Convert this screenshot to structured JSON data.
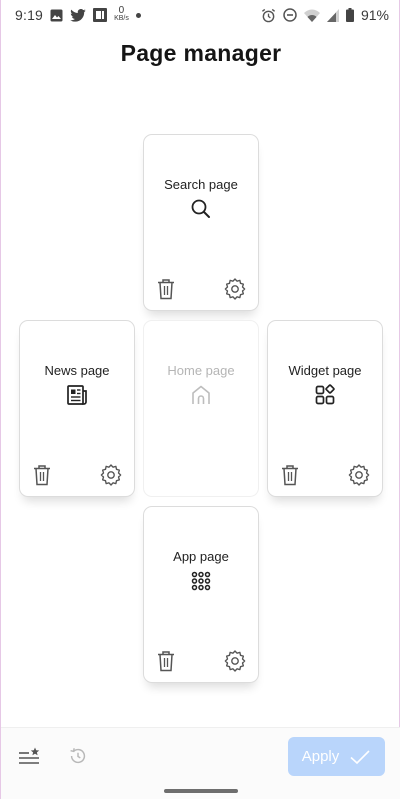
{
  "status_bar": {
    "time": "9:19",
    "net_speed_value": "0",
    "net_speed_unit": "KB/s",
    "battery": "91%",
    "icons": [
      "gallery-icon",
      "twitter-icon",
      "news-app-icon",
      "alarm-icon",
      "dnd-icon",
      "wifi-icon",
      "signal-icon",
      "battery-icon"
    ]
  },
  "title": "Page manager",
  "pages": {
    "search": {
      "label": "Search page",
      "icon": "search-icon"
    },
    "news": {
      "label": "News page",
      "icon": "newspaper-icon"
    },
    "home": {
      "label": "Home page",
      "icon": "home-icon"
    },
    "widget": {
      "label": "Widget page",
      "icon": "widgets-icon"
    },
    "app": {
      "label": "App page",
      "icon": "app-grid-icon"
    }
  },
  "bottom_bar": {
    "apply_label": "Apply",
    "apply_enabled": false
  },
  "colors": {
    "apply_button": "#b9d5fb",
    "home_label_disabled": "#b5b5b5"
  }
}
